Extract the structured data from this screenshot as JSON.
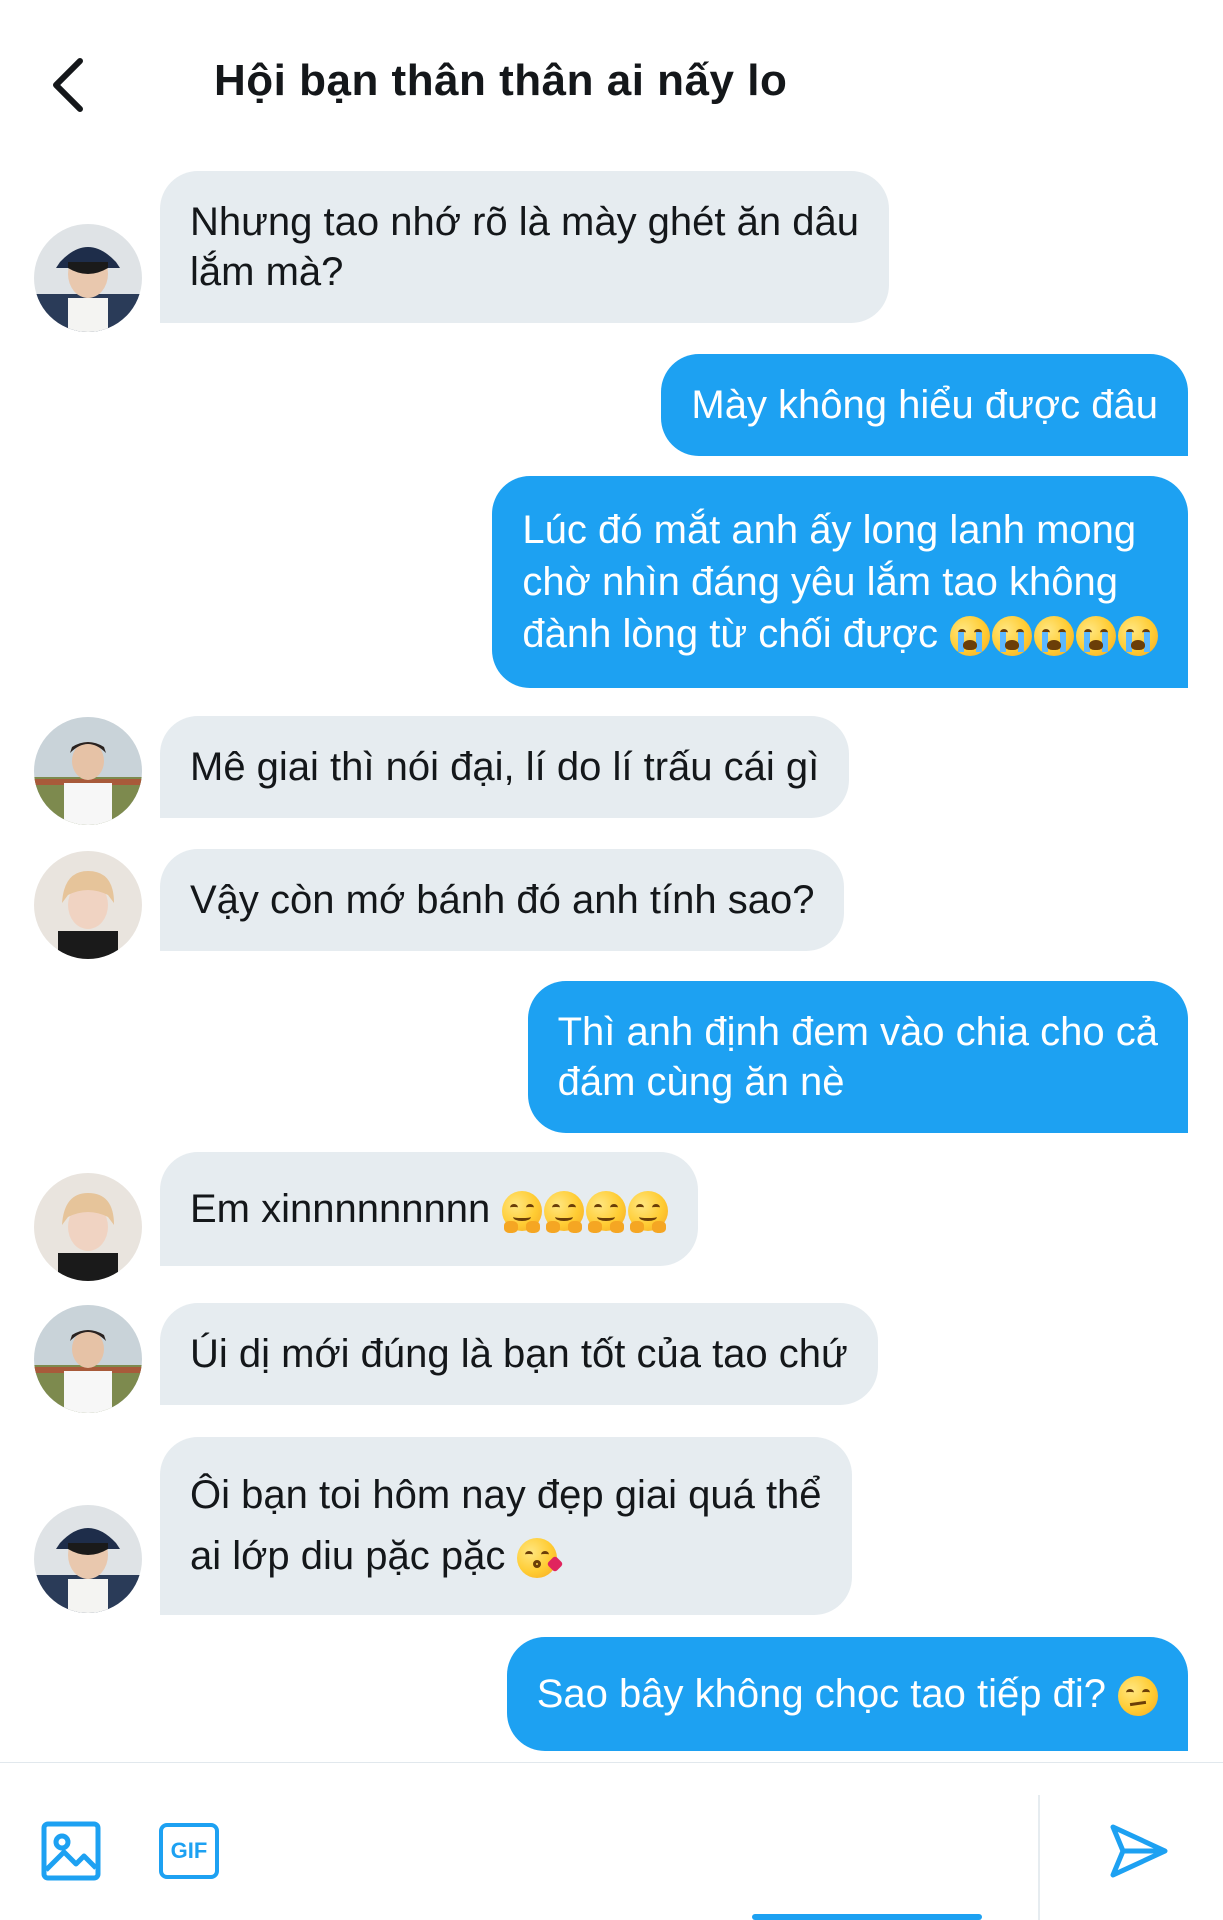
{
  "header": {
    "title": "Hội bạn thân thân ai nấy lo",
    "back_icon": "chevron-left-icon"
  },
  "messages": [
    {
      "side": "in",
      "avatar": "avatar-hat-boy",
      "lines": [
        "Nhưng tao nhớ rõ là mày ghét ăn dâu",
        "lắm mà?"
      ]
    },
    {
      "side": "out",
      "lines": [
        "Mày không hiểu được đâu"
      ]
    },
    {
      "side": "out",
      "lines": [
        "Lúc đó mắt anh ấy long lanh mong",
        "chờ nhìn đáng yêu lắm tao không",
        "đành lòng từ chối được"
      ],
      "emoji": [
        "loudly-crying-face",
        "loudly-crying-face",
        "loudly-crying-face",
        "loudly-crying-face",
        "loudly-crying-face"
      ]
    },
    {
      "side": "in",
      "avatar": "avatar-field-boy",
      "lines": [
        "Mê giai thì nói đại, lí do lí trấu cái gì"
      ]
    },
    {
      "side": "in",
      "avatar": "avatar-blonde-boy",
      "lines": [
        "Vậy còn mớ bánh đó anh tính sao?"
      ]
    },
    {
      "side": "out",
      "lines": [
        "Thì anh định đem vào chia cho cả",
        "đám cùng ăn nè"
      ]
    },
    {
      "side": "in",
      "avatar": "avatar-blonde-boy",
      "lines": [
        "Em xinnnnnnnnn"
      ],
      "emoji": [
        "hugging-face",
        "hugging-face",
        "hugging-face",
        "hugging-face"
      ]
    },
    {
      "side": "in",
      "avatar": "avatar-field-boy",
      "lines": [
        "Úi dị mới đúng là bạn tốt của tao chứ"
      ]
    },
    {
      "side": "in",
      "avatar": "avatar-hat-boy",
      "lines": [
        "Ôi bạn toi hôm nay đẹp giai quá thể",
        "ai lớp diu pặc pặc"
      ],
      "emoji": [
        "face-blowing-kiss"
      ]
    },
    {
      "side": "out",
      "lines": [
        "Sao bây không chọc tao tiếp đi?"
      ],
      "emoji": [
        "unamused-face"
      ]
    }
  ],
  "composer": {
    "image_icon": "image-icon",
    "gif_label": "GIF",
    "send_icon": "send-icon"
  },
  "colors": {
    "accent": "#1da1f2",
    "incoming_bubble": "#e6ecf0",
    "text": "#14171a"
  }
}
